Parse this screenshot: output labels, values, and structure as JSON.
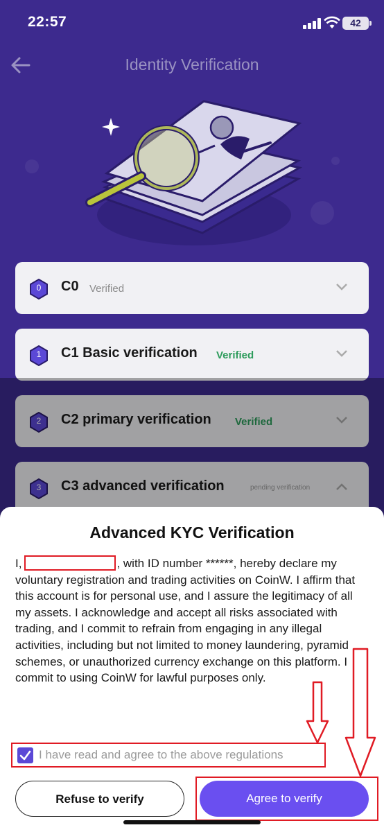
{
  "status_bar": {
    "time": "22:57",
    "battery": "42"
  },
  "header": {
    "title": "Identity Verification"
  },
  "levels": [
    {
      "badge": "0",
      "title": "C0",
      "status": "Verified"
    },
    {
      "badge": "1",
      "title": "C1 Basic verification",
      "status": "Verified"
    },
    {
      "badge": "2",
      "title": "C2 primary verification",
      "status": "Verified"
    },
    {
      "badge": "3",
      "title": "C3 advanced verification",
      "status": "pending verification"
    }
  ],
  "modal": {
    "title": "Advanced KYC Verification",
    "declaration_prefix": "I,",
    "declaration_body": ", with ID number ******, hereby declare my voluntary registration and trading activities on CoinW. I affirm that this account is for personal use, and I assure the legitimacy of all my assets. I acknowledge and accept all risks associated with trading, and I commit to refrain from engaging in any illegal activities, including but not limited to money laundering, pyramid schemes, or unauthorized currency exchange on this platform. I commit to using CoinW for lawful purposes only.",
    "agree_label": "I have read and agree to the above regulations",
    "agree_checked": true,
    "refuse_button": "Refuse to verify",
    "agree_button": "Agree to verify"
  },
  "colors": {
    "background": "#3d2a8e",
    "accent": "#6a4ff0",
    "verified": "#2e9c5c",
    "annotation": "#e01b24"
  },
  "icons": [
    "back-arrow-icon",
    "signal-icon",
    "wifi-icon",
    "battery-icon",
    "magnifier-illustration",
    "hexagon-badge-icon",
    "chevron-down-icon",
    "chevron-up-icon",
    "checkmark-icon",
    "annotation-arrow"
  ]
}
